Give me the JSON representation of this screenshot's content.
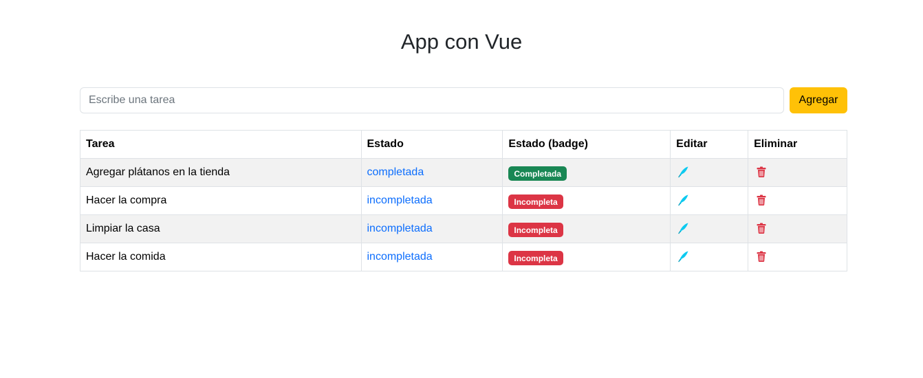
{
  "header": {
    "title": "App con Vue"
  },
  "form": {
    "placeholder": "Escribe una tarea",
    "value": "",
    "add_label": "Agregar"
  },
  "table": {
    "headers": [
      "Tarea",
      "Estado",
      "Estado (badge)",
      "Editar",
      "Eliminar"
    ],
    "rows": [
      {
        "task": "Agregar plátanos en la tienda",
        "status": "completada",
        "badge": "Completada",
        "badge_color": "#198754"
      },
      {
        "task": "Hacer la compra",
        "status": "incompleta",
        "status_text": "incompletada",
        "badge": "Incompleta",
        "badge_color": "#dc3545"
      },
      {
        "task": "Limpiar la casa",
        "status": "incompleta",
        "status_text": "incompletada",
        "badge": "Incompleta",
        "badge_color": "#dc3545"
      },
      {
        "task": "Hacer la comida",
        "status": "incompleta",
        "status_text": "incompletada",
        "badge": "Incompleta",
        "badge_color": "#dc3545"
      }
    ]
  },
  "icons": {
    "edit": "feather-pen-icon",
    "delete": "trash-icon"
  },
  "colors": {
    "accent": "#ffc107",
    "link": "#0d6efd",
    "success": "#198754",
    "danger": "#dc3545",
    "edit_icon": "#0dcaf0"
  }
}
